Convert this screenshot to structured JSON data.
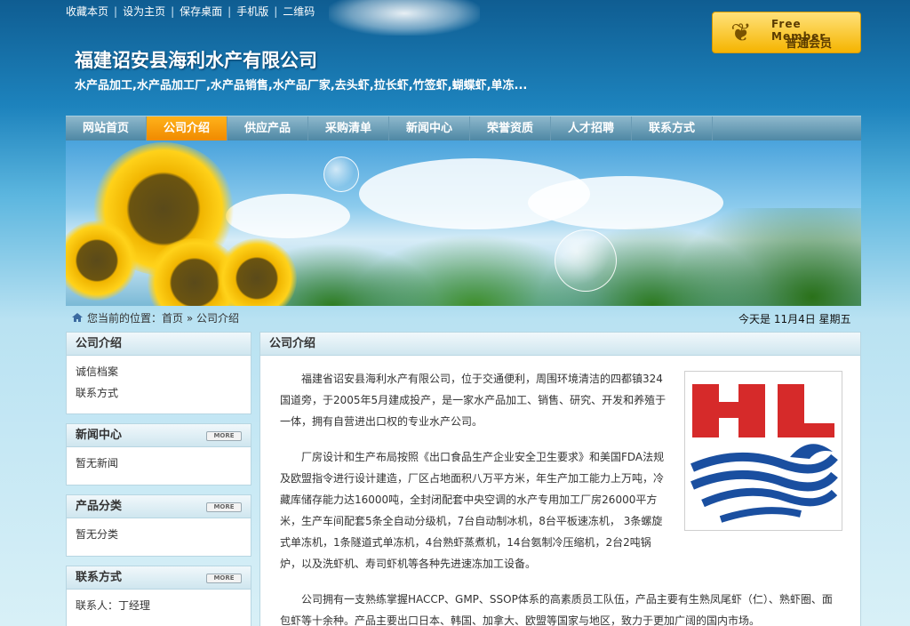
{
  "topbar": {
    "links": [
      "收藏本页",
      "设为主页",
      "保存桌面",
      "手机版",
      "二维码"
    ]
  },
  "member": {
    "line1": "Free Member",
    "line2": "普通会员"
  },
  "header": {
    "company": "福建诏安县海利水产有限公司",
    "tagline": "水产品加工,水产品加工厂,水产品销售,水产品厂家,去头虾,拉长虾,竹签虾,蝴蝶虾,单冻..."
  },
  "nav": [
    "网站首页",
    "公司介绍",
    "供应产品",
    "采购清单",
    "新闻中心",
    "荣誉资质",
    "人才招聘",
    "联系方式"
  ],
  "breadcrumb": {
    "prefix": "您当前的位置：",
    "home": "首页",
    "sep": " » ",
    "current": "公司介绍"
  },
  "date": "今天是 11月4日 星期五",
  "sidebar": {
    "about": {
      "title": "公司介绍",
      "items": [
        "诚信档案",
        "联系方式"
      ]
    },
    "news": {
      "title": "新闻中心",
      "more": "MORE",
      "empty": "暂无新闻"
    },
    "products": {
      "title": "产品分类",
      "more": "MORE",
      "empty": "暂无分类"
    },
    "contact": {
      "title": "联系方式",
      "more": "MORE",
      "person": "联系人：丁经理"
    }
  },
  "main": {
    "title": "公司介绍",
    "p1": "福建省诏安县海利水产有限公司，位于交通便利，周围环境清洁的四都镇324国道旁，于2005年5月建成投产，是一家水产品加工、销售、研究、开发和养殖于一体，拥有自营进出口权的专业水产公司。",
    "p2": "厂房设计和生产布局按照《出口食品生产企业安全卫生要求》和美国FDA法规及欧盟指令进行设计建造，厂区占地面积八万平方米，年生产加工能力上万吨，冷藏库储存能力达16000吨，全封闭配套中央空调的水产专用加工厂房26000平方米，生产车间配套5条全自动分级机，7台自动制冰机，8台平板速冻机， 3条螺旋式单冻机，1条隧道式单冻机，4台熟虾蒸煮机，14台氨制冷压缩机，2台2吨锅炉，以及洗虾机、寿司虾机等各种先进速冻加工设备。",
    "p3": "公司拥有一支熟练掌握HACCP、GMP、SSOP体系的高素质员工队伍，产品主要有生熟凤尾虾（仁）、熟虾圈、面包虾等十余种。产品主要出口日本、韩国、加拿大、欧盟等国家与地区，致力于更加广阔的国内市场。"
  },
  "colors": {
    "accent": "#f08a00",
    "nav": "#4d87a4",
    "logo_red": "#d62a2a",
    "logo_blue": "#1a4fa0"
  }
}
